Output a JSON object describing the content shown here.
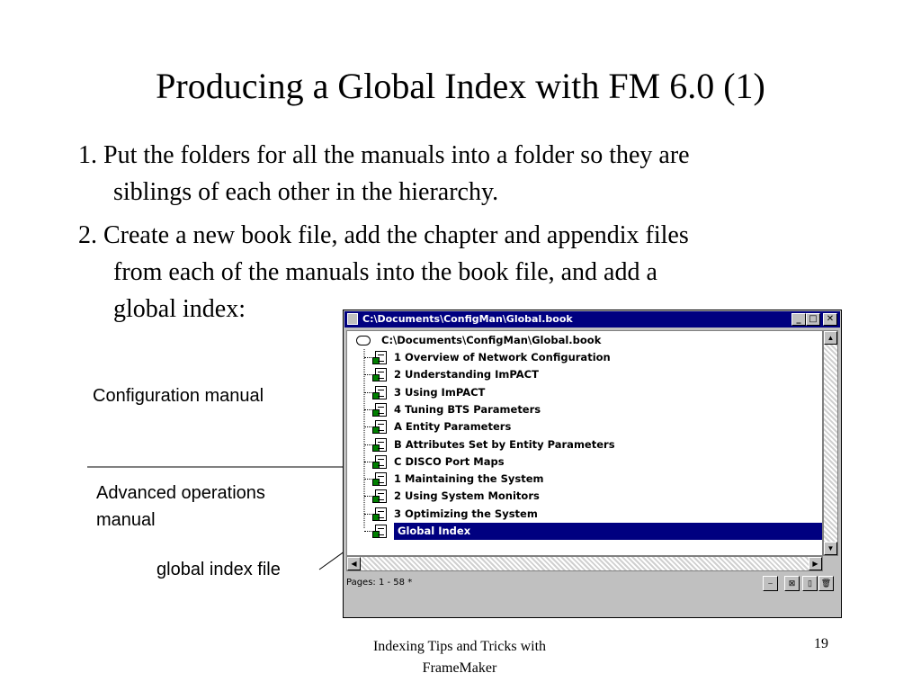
{
  "slide": {
    "title": "Producing a Global Index with FM 6.0 (1)",
    "bullets": [
      "1. Put the folders for all the manuals into a folder so they are",
      "siblings of each other in the hierarchy.",
      "2. Create a new book file, add the chapter and appendix files",
      "from each of the manuals into the book file, and add a",
      "global index:"
    ],
    "annotations": {
      "config_manual": "Configuration manual",
      "advanced_line1": "Advanced operations",
      "advanced_line2": "manual",
      "index_file": "global index file"
    },
    "footer": {
      "line1": "Indexing Tips and Tricks with",
      "line2": "FrameMaker",
      "page": "19"
    }
  },
  "window": {
    "title": "C:\\Documents\\ConfigMan\\Global.book",
    "root": "C:\\Documents\\ConfigMan\\Global.book",
    "items": [
      "1 Overview of Network Configuration",
      "2 Understanding ImPACT",
      "3 Using ImPACT",
      "4 Tuning BTS Parameters",
      "A Entity Parameters",
      "B Attributes Set by Entity Parameters",
      "C DISCO Port Maps",
      "1 Maintaining the System",
      "2 Using System Monitors",
      "3 Optimizing the System",
      "Global Index"
    ],
    "selected_index": 10,
    "status_text": "Pages: 1 - 58 *",
    "colors": {
      "titlebar": "#000080",
      "selection": "#000080",
      "chrome": "#c0c0c0"
    }
  }
}
